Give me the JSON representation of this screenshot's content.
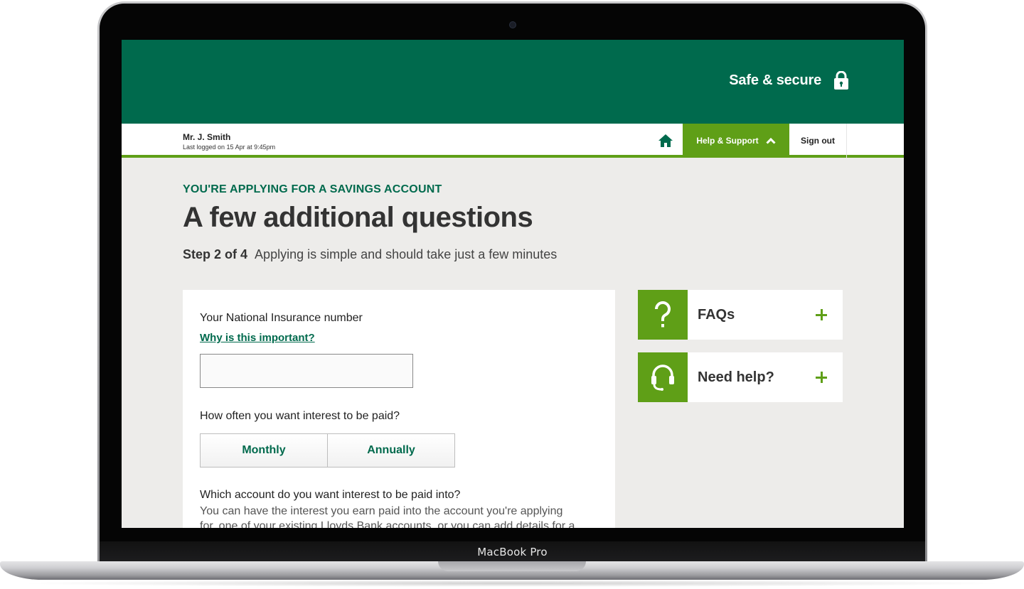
{
  "device": {
    "label": "MacBook Pro"
  },
  "banner": {
    "safe_label": "Safe & secure"
  },
  "nav": {
    "user_name": "Mr. J. Smith",
    "last_logged": "Last logged on 15 Apr at 9:45pm",
    "help_label": "Help & Support",
    "signout_label": "Sign out"
  },
  "header": {
    "kicker": "YOU'RE APPLYING FOR A SAVINGS ACCOUNT",
    "title": "A few additional questions",
    "step": "Step 2 of 4",
    "step_desc": "Applying is simple and should take just a few minutes"
  },
  "form": {
    "ni_label": "Your National Insurance number",
    "ni_link": "Why is this important?",
    "ni_value": "",
    "interest_label": "How often you want interest to be paid?",
    "interest_options": [
      "Monthly",
      "Annually"
    ],
    "account_label": "Which account do you want interest to be paid into?",
    "account_desc": "You can have the interest you earn paid into the account you're applying for, one of your existing Lloyds Bank accounts, or you can add details for a"
  },
  "sidebar": {
    "faq_label": "FAQs",
    "help_label": "Need help?"
  },
  "colors": {
    "brand_green": "#006a4d",
    "accent_green": "#5f9f17",
    "background": "#edecea"
  }
}
